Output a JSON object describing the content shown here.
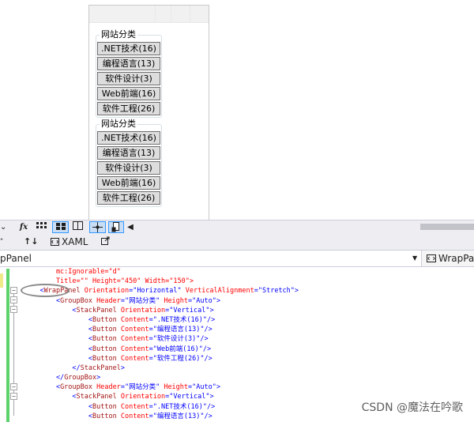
{
  "designer": {
    "groups": [
      {
        "header": "网站分类",
        "buttons": [
          ".NET技术(16)",
          "编程语言(13)",
          "软件设计(3)",
          "Web前端(16)",
          "软件工程(26)"
        ]
      },
      {
        "header": "网站分类",
        "buttons": [
          ".NET技术(16)",
          "编程语言(13)",
          "软件设计(3)",
          "Web前端(16)",
          "软件工程(26)"
        ]
      }
    ]
  },
  "toolbar": {
    "fx_label": "fx",
    "icons": [
      "grid-icon",
      "snap-grid-icon",
      "snap-lines-icon",
      "layout-toggle-icon",
      "scroll-left-icon"
    ]
  },
  "tabs": {
    "swap_label": "↑↓",
    "xaml_label": "XAML",
    "popout_icon": "popout-icon"
  },
  "navbar": {
    "left_text": "pPanel",
    "right_text": "WrapPa"
  },
  "code": {
    "lines": [
      [
        {
          "t": "        mc:Ignorable=\"d\"",
          "c": "at"
        }
      ],
      [
        {
          "t": "        Title=\"\" Height=\"450\" Width=\"150\">",
          "c": "at"
        }
      ],
      [
        {
          "t": "    <",
          "c": "pn"
        },
        {
          "t": "WrapPanel",
          "c": "kw"
        },
        {
          "t": " Orientation",
          "c": "at"
        },
        {
          "t": "=\"Horizontal\"",
          "c": "vl"
        },
        {
          "t": " VerticalAlignment",
          "c": "at"
        },
        {
          "t": "=\"Stretch\"",
          "c": "vl"
        },
        {
          "t": ">",
          "c": "pn"
        }
      ],
      [
        {
          "t": "        <",
          "c": "pn"
        },
        {
          "t": "GroupBox",
          "c": "kw"
        },
        {
          "t": " Header",
          "c": "at"
        },
        {
          "t": "=\"网站分类\"",
          "c": "vl"
        },
        {
          "t": " Height",
          "c": "at"
        },
        {
          "t": "=\"Auto\"",
          "c": "vl"
        },
        {
          "t": ">",
          "c": "pn"
        }
      ],
      [
        {
          "t": "            <",
          "c": "pn"
        },
        {
          "t": "StackPanel",
          "c": "kw"
        },
        {
          "t": " Orientation",
          "c": "at"
        },
        {
          "t": "=\"Vertical\"",
          "c": "vl"
        },
        {
          "t": ">",
          "c": "pn"
        }
      ],
      [
        {
          "t": "                <",
          "c": "pn"
        },
        {
          "t": "Button",
          "c": "kw"
        },
        {
          "t": " Content",
          "c": "at"
        },
        {
          "t": "=\".NET技术(16)\"",
          "c": "vl"
        },
        {
          "t": "/>",
          "c": "pn"
        }
      ],
      [
        {
          "t": "                <",
          "c": "pn"
        },
        {
          "t": "Button",
          "c": "kw"
        },
        {
          "t": " Content",
          "c": "at"
        },
        {
          "t": "=\"编程语言(13)\"",
          "c": "vl"
        },
        {
          "t": "/>",
          "c": "pn"
        }
      ],
      [
        {
          "t": "                <",
          "c": "pn"
        },
        {
          "t": "Button",
          "c": "kw"
        },
        {
          "t": " Content",
          "c": "at"
        },
        {
          "t": "=\"软件设计(3)\"",
          "c": "vl"
        },
        {
          "t": "/>",
          "c": "pn"
        }
      ],
      [
        {
          "t": "                <",
          "c": "pn"
        },
        {
          "t": "Button",
          "c": "kw"
        },
        {
          "t": " Content",
          "c": "at"
        },
        {
          "t": "=\"Web前端(16)\"",
          "c": "vl"
        },
        {
          "t": "/>",
          "c": "pn"
        }
      ],
      [
        {
          "t": "                <",
          "c": "pn"
        },
        {
          "t": "Button",
          "c": "kw"
        },
        {
          "t": " Content",
          "c": "at"
        },
        {
          "t": "=\"软件工程(26)\"",
          "c": "vl"
        },
        {
          "t": "/>",
          "c": "pn"
        }
      ],
      [
        {
          "t": "            </",
          "c": "pn"
        },
        {
          "t": "StackPanel",
          "c": "kw"
        },
        {
          "t": ">",
          "c": "pn"
        }
      ],
      [
        {
          "t": "        </",
          "c": "pn"
        },
        {
          "t": "GroupBox",
          "c": "kw"
        },
        {
          "t": ">",
          "c": "pn"
        }
      ],
      [
        {
          "t": "        <",
          "c": "pn"
        },
        {
          "t": "GroupBox",
          "c": "kw"
        },
        {
          "t": " Header",
          "c": "at"
        },
        {
          "t": "=\"网站分类\"",
          "c": "vl"
        },
        {
          "t": " Height",
          "c": "at"
        },
        {
          "t": "=\"Auto\"",
          "c": "vl"
        },
        {
          "t": ">",
          "c": "pn"
        }
      ],
      [
        {
          "t": "            <",
          "c": "pn"
        },
        {
          "t": "StackPanel",
          "c": "kw"
        },
        {
          "t": " Orientation",
          "c": "at"
        },
        {
          "t": "=\"Vertical\"",
          "c": "vl"
        },
        {
          "t": ">",
          "c": "pn"
        }
      ],
      [
        {
          "t": "                <",
          "c": "pn"
        },
        {
          "t": "Button",
          "c": "kw"
        },
        {
          "t": " Content",
          "c": "at"
        },
        {
          "t": "=\".NET技术(16)\"",
          "c": "vl"
        },
        {
          "t": "/>",
          "c": "pn"
        }
      ],
      [
        {
          "t": "                <",
          "c": "pn"
        },
        {
          "t": "Button",
          "c": "kw"
        },
        {
          "t": " Content",
          "c": "at"
        },
        {
          "t": "=\"编程语言(13)\"",
          "c": "vl"
        },
        {
          "t": "/>",
          "c": "pn"
        }
      ]
    ]
  },
  "watermark": "CSDN @魔法在吟歌",
  "colors": {
    "gutter_green": "#5cd36b",
    "gutter_yellow": "#efe98a",
    "selection": "#3399ff"
  }
}
